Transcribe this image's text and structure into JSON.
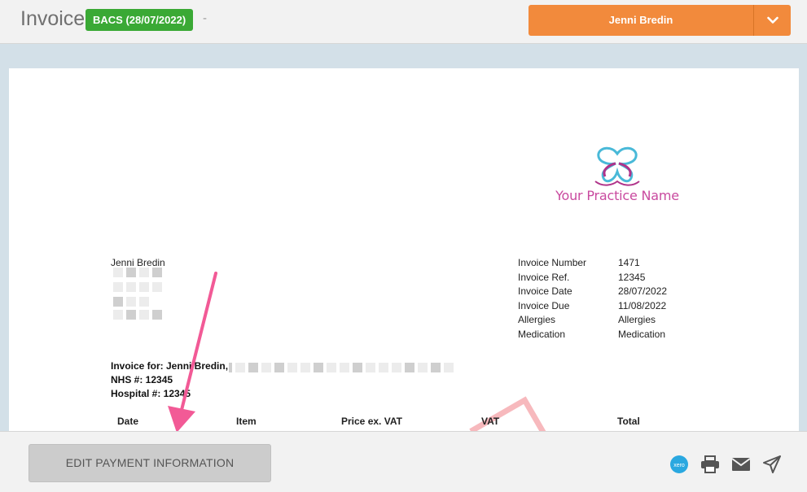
{
  "header": {
    "title": "Invoice",
    "status_badge": "BACS (28/07/2022)",
    "separator": "-",
    "user_button_label": "Jenni Bredin",
    "colors": {
      "badge": "#3aa935",
      "user_button": "#f28a3c"
    }
  },
  "logo": {
    "practice_name": "Your Practice Name"
  },
  "patient": {
    "name": "Jenni Bredin"
  },
  "invoice_meta": [
    {
      "label": "Invoice Number",
      "value": "1471"
    },
    {
      "label": "Invoice Ref.",
      "value": "12345"
    },
    {
      "label": "Invoice Date",
      "value": "28/07/2022"
    },
    {
      "label": "Invoice Due",
      "value": "11/08/2022"
    },
    {
      "label": "Allergies",
      "value": "Allergies"
    },
    {
      "label": "Medication",
      "value": "Medication"
    }
  ],
  "billing": {
    "invoice_for": "Invoice for: Jenni Bredin,",
    "nhs": "NHS #: 12345",
    "hospital": "Hospital #: 12345"
  },
  "table": {
    "columns": [
      "Date",
      "Item",
      "Price ex. VAT",
      "VAT",
      "Total"
    ]
  },
  "footer": {
    "edit_button_label": "EDIT PAYMENT INFORMATION",
    "xero_label": "xero",
    "icons": [
      "xero-icon",
      "print-icon",
      "mail-icon",
      "send-icon"
    ]
  }
}
